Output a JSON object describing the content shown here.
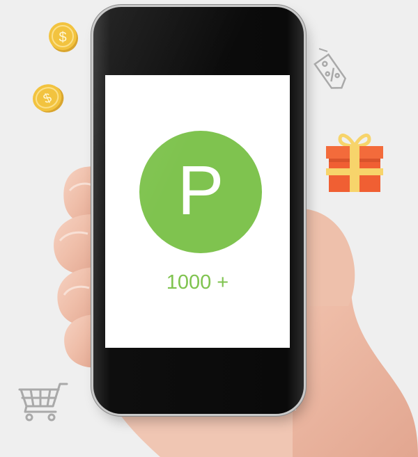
{
  "screen": {
    "badge_letter": "P",
    "points_label": "1000 +"
  },
  "icons": [
    {
      "name": "dollar-coin-icon"
    },
    {
      "name": "dollar-coin-icon"
    },
    {
      "name": "price-tag-percent-icon"
    },
    {
      "name": "gift-box-icon"
    },
    {
      "name": "shopping-cart-icon"
    }
  ],
  "colors": {
    "background": "#efefef",
    "accent_green": "#7fc34f",
    "coin_gold": "#f2c33f",
    "gift_orange": "#f36b3b",
    "gift_ribbon": "#f7d46b",
    "icon_gray": "#a9a9a9"
  }
}
